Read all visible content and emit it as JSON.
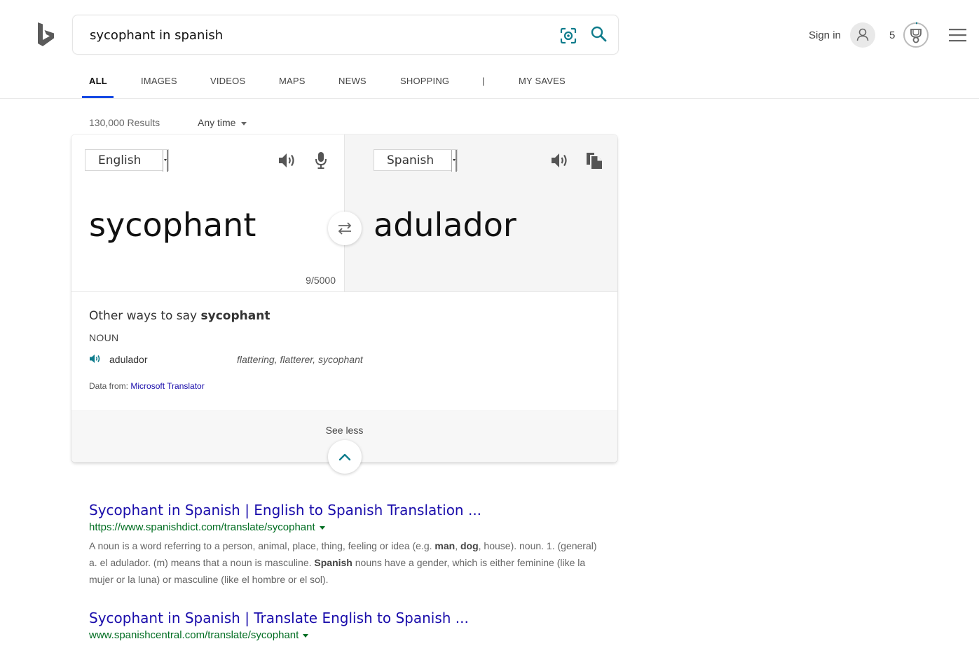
{
  "search": {
    "query": "sycophant in spanish"
  },
  "header": {
    "sign_in": "Sign in",
    "rewards_count": "5"
  },
  "nav": {
    "tabs": [
      {
        "label": "ALL"
      },
      {
        "label": "IMAGES"
      },
      {
        "label": "VIDEOS"
      },
      {
        "label": "MAPS"
      },
      {
        "label": "NEWS"
      },
      {
        "label": "SHOPPING"
      },
      {
        "label": "|"
      },
      {
        "label": "MY SAVES"
      }
    ]
  },
  "results_info": {
    "count": "130,000 Results",
    "time_filter": "Any time"
  },
  "translator": {
    "source_lang": "English",
    "target_lang": "Spanish",
    "source_text": "sycophant",
    "target_text": "adulador",
    "char_count": "9/5000",
    "other_ways_prefix": "Other ways to say ",
    "other_ways_word": "sycophant",
    "part_of_speech": "NOUN",
    "alternatives": [
      {
        "word": "adulador",
        "synonyms": "flattering, flatterer, sycophant"
      }
    ],
    "data_from_label": "Data from: ",
    "data_from_source": "Microsoft Translator",
    "see_less": "See less"
  },
  "results": [
    {
      "title": "Sycophant in Spanish | English to Spanish Translation ...",
      "url": "https://www.spanishdict.com/translate/sycophant",
      "snippet": [
        {
          "t": "A noun is a word referring to a person, animal, place, thing, feeling or idea (e.g. "
        },
        {
          "b": "man"
        },
        {
          "t": ", "
        },
        {
          "b": "dog"
        },
        {
          "t": ", house). noun. 1. (general) a. el adulador. (m) means that a noun is masculine. "
        },
        {
          "b": "Spanish"
        },
        {
          "t": " nouns have a gender, which is either feminine (like la mujer or la luna) or masculine (like el hombre or el sol)."
        }
      ]
    },
    {
      "title": "Sycophant in Spanish | Translate English to Spanish ...",
      "url": "www.spanishcentral.com/translate/sycophant"
    }
  ],
  "colors": {
    "accent": "#174ae4",
    "link": "#1a0dab",
    "url": "#006d21",
    "teal_icon": "#0f7c8c"
  }
}
